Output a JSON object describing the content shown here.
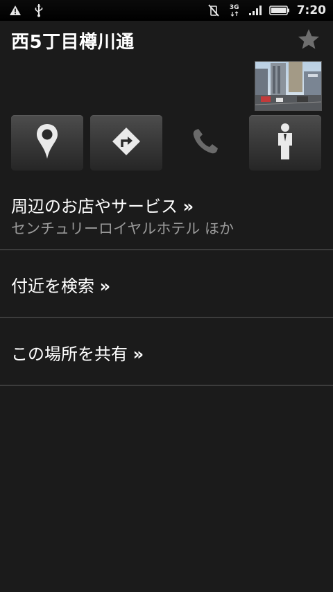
{
  "status_bar": {
    "time": "7:20",
    "network": "3G",
    "icons": [
      "warning-icon",
      "usb-icon",
      "vibrate-off-icon",
      "signal-icon",
      "battery-icon"
    ]
  },
  "place": {
    "title": "西5丁目樽川通",
    "favorite_icon": "star-icon"
  },
  "actions": [
    {
      "name": "map-pin",
      "icon": "map-pin-icon"
    },
    {
      "name": "directions",
      "icon": "directions-icon"
    },
    {
      "name": "call",
      "icon": "phone-icon"
    },
    {
      "name": "street-view",
      "icon": "pegman-icon"
    }
  ],
  "menu": {
    "nearby": {
      "label": "周辺のお店やサービス",
      "chevron": "»",
      "subtitle": "センチュリーロイヤルホテル ほか"
    },
    "search_nearby": {
      "label": "付近を検索",
      "chevron": "»"
    },
    "share": {
      "label": "この場所を共有",
      "chevron": "»"
    }
  },
  "colors": {
    "background": "#1b1b1b",
    "divider": "#3c3c3c",
    "subtitle": "#9a9a9a",
    "star": "#6e6e6e"
  }
}
